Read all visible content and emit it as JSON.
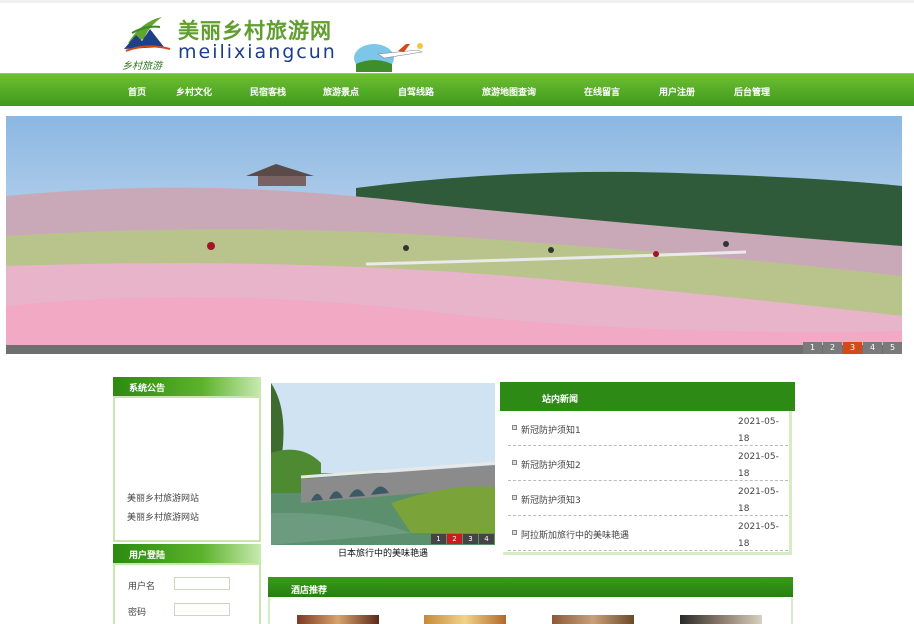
{
  "header": {
    "site_name_cn": "美丽乡村旅游网",
    "site_name_en": "meilixiangcun",
    "logo_script": "乡村旅游"
  },
  "nav": {
    "items": [
      {
        "label": "首页"
      },
      {
        "label": "乡村文化"
      },
      {
        "label": "民宿客栈"
      },
      {
        "label": "旅游景点"
      },
      {
        "label": "自驾线路"
      },
      {
        "label": "旅游地图查询"
      },
      {
        "label": "在线留言"
      },
      {
        "label": "用户注册"
      },
      {
        "label": "后台管理"
      }
    ]
  },
  "banner": {
    "pages": [
      "1",
      "2",
      "3",
      "4",
      "5"
    ],
    "active_page": "3"
  },
  "notice": {
    "title": "系统公告",
    "lines": [
      "美丽乡村旅游网站",
      "美丽乡村旅游网站"
    ]
  },
  "login": {
    "title": "用户登陆",
    "username_label": "用户名",
    "password_label": "密码",
    "username_value": "",
    "password_value": ""
  },
  "photo": {
    "caption": "日本旅行中的美味艳遇",
    "pages": [
      "1",
      "2",
      "3",
      "4"
    ],
    "active_page": "2"
  },
  "news": {
    "title": "站内新闻",
    "items": [
      {
        "title": "新冠防护须知1",
        "date": "2021-05-18"
      },
      {
        "title": "新冠防护须知2",
        "date": "2021-05-18"
      },
      {
        "title": "新冠防护须知3",
        "date": "2021-05-18"
      },
      {
        "title": "阿拉斯加旅行中的美味艳遇",
        "date": "2021-05-18"
      }
    ]
  },
  "hotel": {
    "title": "酒店推荐"
  },
  "colors": {
    "nav_green": "#4ca522",
    "accent_green": "#2d8a14",
    "pager_active": "#d24a16"
  }
}
